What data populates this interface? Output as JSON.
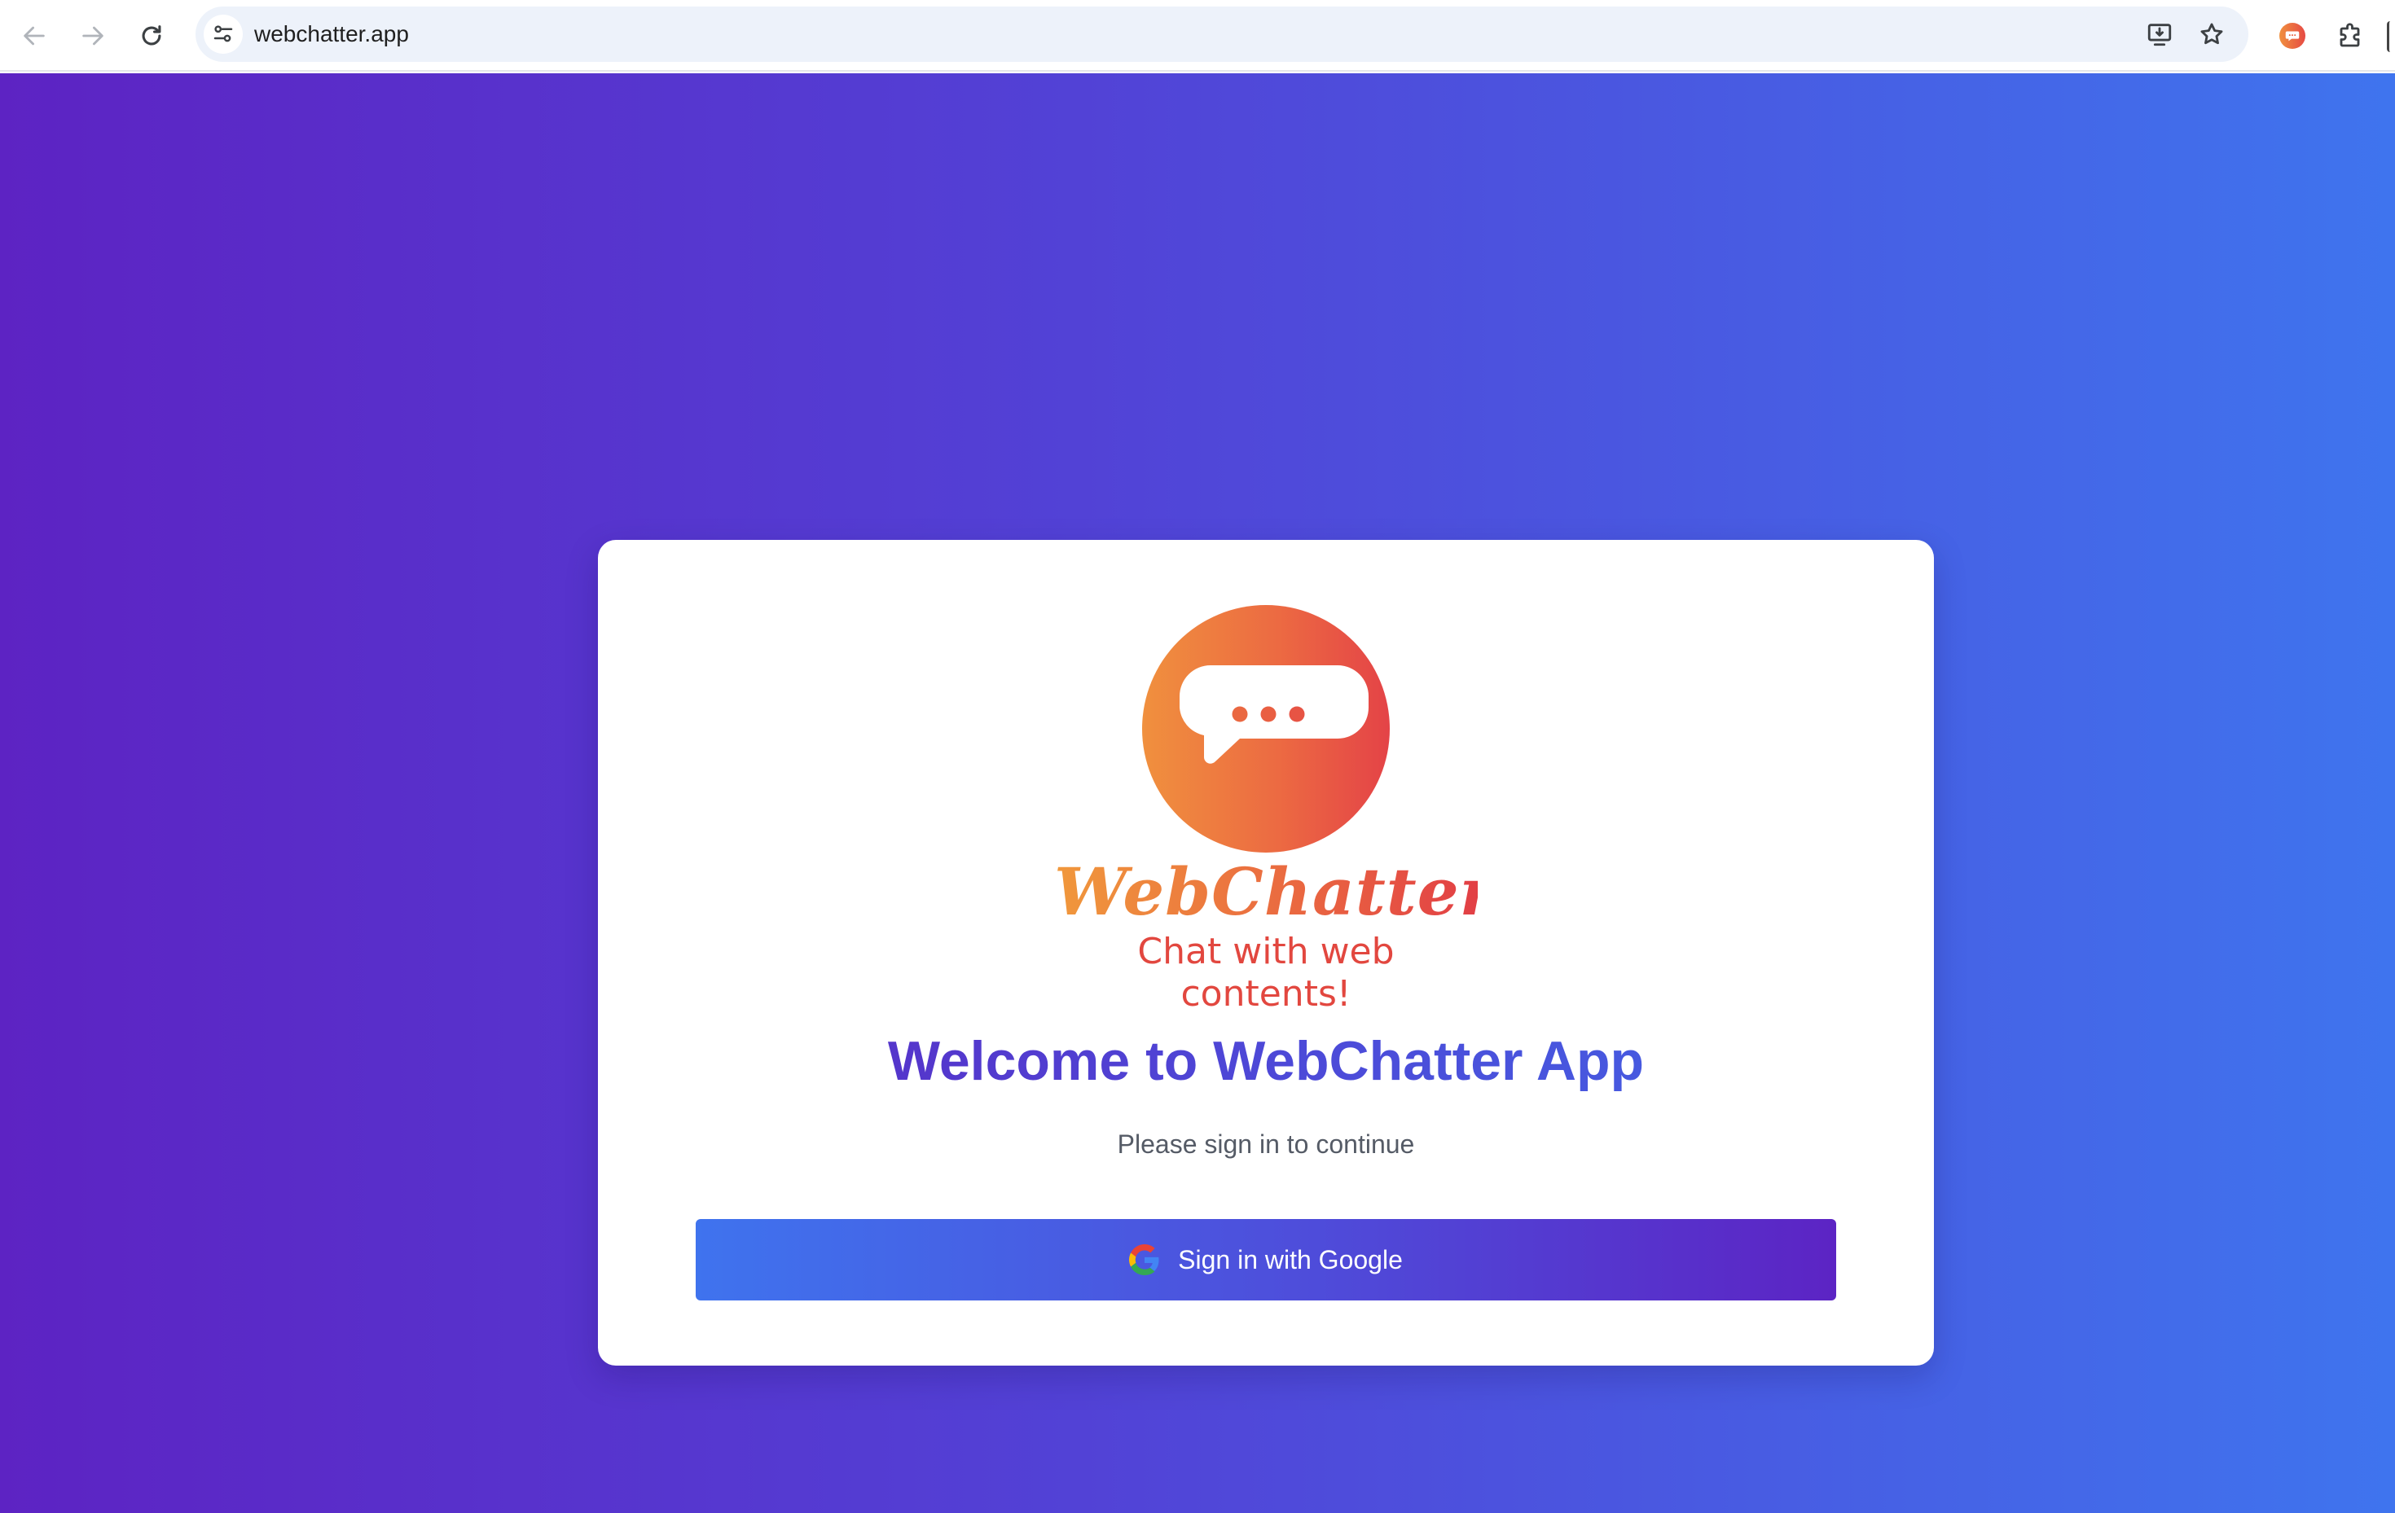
{
  "browser": {
    "url": "webchatter.app"
  },
  "logo": {
    "brand_name": "WebChatter",
    "tagline": "Chat with web contents!"
  },
  "card": {
    "title": "Welcome to WebChatter App",
    "subtitle": "Please sign in to continue",
    "signin_label": "Sign in with Google"
  },
  "colors": {
    "gradient_start": "#5d23c3",
    "gradient_end": "#3f74ee",
    "logo_orange": "#f0903e",
    "logo_red": "#e44347"
  },
  "icons": {
    "back": "arrow-left-icon",
    "forward": "arrow-right-icon",
    "reload": "reload-icon",
    "site_info": "tune-icon",
    "install": "install-app-icon",
    "bookmark": "star-icon",
    "extension": "webchatter-extension-icon",
    "extensions_menu": "puzzle-icon",
    "chat_bubble": "chat-bubble-icon",
    "google": "google-g-icon"
  }
}
